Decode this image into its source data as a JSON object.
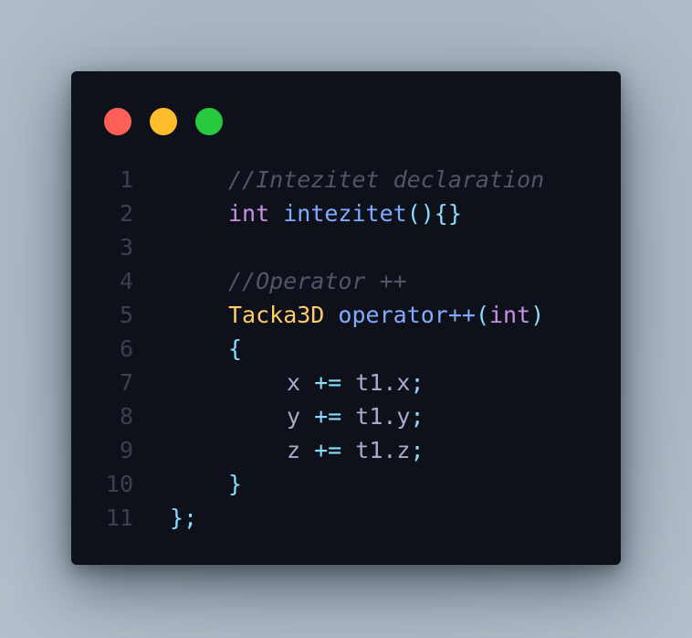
{
  "window": {
    "controls": [
      {
        "name": "close",
        "color": "#ff5f56"
      },
      {
        "name": "minimize",
        "color": "#ffbd2e"
      },
      {
        "name": "maximize",
        "color": "#27c93f"
      }
    ]
  },
  "colors": {
    "background": "#0e111a",
    "comment": "#4f566b",
    "keyword": "#c792ea",
    "function": "#82aaff",
    "punctuation": "#89ddff",
    "type": "#ffcb6b",
    "text": "#a6accd",
    "line_number": "#3a4050"
  },
  "code": {
    "lines": [
      {
        "number": "1",
        "indent": 1,
        "tokens": [
          {
            "text": "//Intezitet declaration",
            "type": "comment"
          }
        ]
      },
      {
        "number": "2",
        "indent": 1,
        "tokens": [
          {
            "text": "int",
            "type": "keyword"
          },
          {
            "text": " ",
            "type": "text"
          },
          {
            "text": "intezitet",
            "type": "function"
          },
          {
            "text": "(){}",
            "type": "punct"
          }
        ]
      },
      {
        "number": "3",
        "indent": 1,
        "tokens": []
      },
      {
        "number": "4",
        "indent": 1,
        "tokens": [
          {
            "text": "//Operator ++",
            "type": "comment"
          }
        ]
      },
      {
        "number": "5",
        "indent": 1,
        "tokens": [
          {
            "text": "Tacka3D",
            "type": "type"
          },
          {
            "text": " ",
            "type": "text"
          },
          {
            "text": "operator++",
            "type": "function"
          },
          {
            "text": "(",
            "type": "punct"
          },
          {
            "text": "int",
            "type": "keyword"
          },
          {
            "text": ")",
            "type": "punct"
          }
        ]
      },
      {
        "number": "6",
        "indent": 1,
        "tokens": [
          {
            "text": "{",
            "type": "punct"
          }
        ]
      },
      {
        "number": "7",
        "indent": 2,
        "tokens": [
          {
            "text": "x ",
            "type": "text"
          },
          {
            "text": "+=",
            "type": "op"
          },
          {
            "text": " t1.x",
            "type": "text"
          },
          {
            "text": ";",
            "type": "punct"
          }
        ]
      },
      {
        "number": "8",
        "indent": 2,
        "tokens": [
          {
            "text": "y ",
            "type": "text"
          },
          {
            "text": "+=",
            "type": "op"
          },
          {
            "text": " t1.y",
            "type": "text"
          },
          {
            "text": ";",
            "type": "punct"
          }
        ]
      },
      {
        "number": "9",
        "indent": 2,
        "tokens": [
          {
            "text": "z ",
            "type": "text"
          },
          {
            "text": "+=",
            "type": "op"
          },
          {
            "text": " t1.z",
            "type": "text"
          },
          {
            "text": ";",
            "type": "punct"
          }
        ]
      },
      {
        "number": "10",
        "indent": 1,
        "tokens": [
          {
            "text": "}",
            "type": "punct"
          }
        ]
      },
      {
        "number": "11",
        "indent": 0,
        "tokens": [
          {
            "text": "};",
            "type": "punct"
          }
        ]
      }
    ]
  }
}
